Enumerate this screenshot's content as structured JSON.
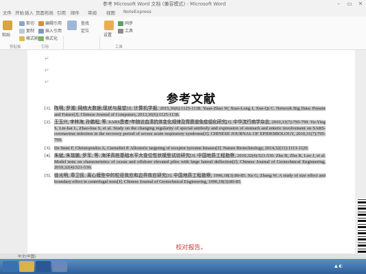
{
  "window": {
    "title": "参考 Microsoft Word 文档 (兼容模式) - Microsoft Word"
  },
  "tabs": [
    "文件",
    "开始",
    "插入",
    "页面布局",
    "引用",
    "邮件",
    "审阅",
    "视图",
    "NoteExpress"
  ],
  "ribbon": {
    "paste": "粘贴",
    "cut": "剪切",
    "copy": "复制",
    "format_painter": "格式刷",
    "edit_reference": "编辑引用",
    "insert_reference": "插入引用",
    "format_group": "格式化",
    "find": "查找",
    "goto": "定位",
    "settings": "设置",
    "sync": "同步",
    "tools": "工具",
    "groups": {
      "clipboard": "剪贴板",
      "reference": "引用",
      "tools": "工具"
    }
  },
  "document": {
    "title": "参考文献",
    "references": [
      {
        "num": "[1].",
        "text": "陈明,  罗湘.  网络大数据:现状与展望[J].  计算机学报,  2015,36(6):1125-1138. Yuan-Zhao W, Xiao-Long J, Xue-Qi C. Network Big Data: Present and Future[J]. Chinese Journal of Computers, 2013,36(6):1125-1138."
      },
      {
        "num": "[2].",
        "text": "王玉兴, 李林海, 孙鹏程, 等. SARS患者7年随访血清抗体变化规律及胃肠道免疫组化研究[J]. 中华流行病学杂志, 2010,31(7):795-799. Yu-Ying S, Lin-hai L, Zhao-hua S, et al. Study on the changing regularity of special antibody and expression of stomach and enteric involvement on SARS-coronavirus infection in the recovery period of severe acute respiratory syndrome[J]. CHINESE JOURNAL OF EPIDEMIOLOGY, 2010,31(7):795-799."
      },
      {
        "num": "[3].",
        "text": "De Smet F, Christopoulos A, Carmeliet P. Allosteric targeting of receptor tyrosine kinases[J]. Nature Biotechnology, 2014,32(11):1113-1120."
      },
      {
        "num": "[4].",
        "text": "朱斌, 朱瑞鹏, 罗军, 等. 海洋高桩基础水平大变位性状模型试验研究[J]. 中国地质工程勘察, 2010,32(4):521-530. Zhu B, Zhu R, Luo J, et al. Model tests on characteristics of ocean and offshore elevated piles with large lateral deflection[J]. Chinese Journal of Geotechnical Engineering, 2010,32(4):521-530."
      },
      {
        "num": "[5].",
        "text": "徐光明, 章卫民. 离心模型中的粒径效应和边界效应研究[J]. 中国地质工程勘察, 1996,18(3):80-85. Xu G, Zhang W. A study of size effect and boundary effect in centrifugal tests[J]. Chinese Journal of Geotechnical Engineering, 1996,18(3):80-85."
      }
    ],
    "footer_note": "校对报告。"
  },
  "status": {
    "lang": "中文(中国)"
  },
  "colors": {
    "accent": "#2f5f98",
    "highlight": "#c9c9c9",
    "red_note": "#d23a3a"
  }
}
